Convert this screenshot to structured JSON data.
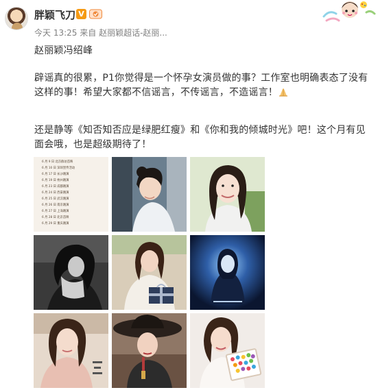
{
  "post": {
    "username": "胖颖飞刀",
    "verified_badge": "V",
    "meta": {
      "time": "今天 13:25",
      "via": "来自",
      "source": "赵丽颖超话-赵丽..."
    },
    "paragraphs": [
      "赵丽颖冯绍峰",
      "辟谣真的很累，P1你觉得是一个怀孕女演员做的事？工作室也明确表态了没有这样的事！希望大家都不信谣言，不传谣言，不造谣言！",
      "还是静等《知否知否应是绿肥红瘦》和《你和我的倾城时光》吧！这个月有见面会哦，也是超级期待了！"
    ],
    "icons": {
      "avatar": "user-avatar",
      "verified": "verified-badge-icon",
      "fan": "fan-badge-icon",
      "decoration": "cartoon-decoration-icon",
      "emoji": "pray-hands-emoji"
    },
    "colors": {
      "text": "#333333",
      "meta": "#808080",
      "verified": "#f59a14"
    },
    "photos": [
      {
        "label": "schedule-list-image",
        "rows": [
          "6 月 9 日 北京群访首映",
          "6 月 10 日 深圳宣传活动",
          "6 月 17 日 长沙路演",
          "6 月 19 日 杭州路演",
          "6 月 23 日 成都路演",
          "6 月 24 日 西安路演",
          "6 月 25 日 武汉路演",
          "6 月 26 日 南京路演",
          "6 月 27 日 上海路演",
          "6 月 28 日 北京首映",
          "6 月 29 日 重庆路演",
          "6 月 30 日 沈阳路演"
        ]
      },
      {
        "label": "portrait-photo-2"
      },
      {
        "label": "portrait-photo-3"
      },
      {
        "label": "portrait-photo-4"
      },
      {
        "label": "portrait-photo-5"
      },
      {
        "label": "portrait-photo-6"
      },
      {
        "label": "portrait-photo-7"
      },
      {
        "label": "portrait-photo-8"
      },
      {
        "label": "portrait-photo-9"
      }
    ]
  }
}
